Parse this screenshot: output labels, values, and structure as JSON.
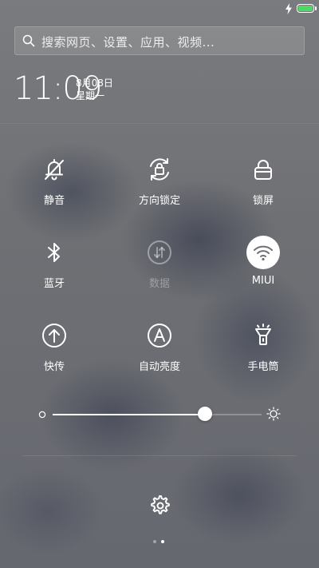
{
  "status_bar": {
    "icons": [
      "charging-icon",
      "battery-icon"
    ],
    "battery_color": "#4cd964"
  },
  "search": {
    "placeholder": "搜索网页、设置、应用、视频..."
  },
  "clock": {
    "time": "11:09",
    "date": "8月08日",
    "weekday": "星期一"
  },
  "toggles": [
    {
      "label": "静音",
      "icon": "bell-off-icon",
      "active": false,
      "disabled": false
    },
    {
      "label": "方向锁定",
      "icon": "rotation-lock-icon",
      "active": false,
      "disabled": false
    },
    {
      "label": "锁屏",
      "icon": "lock-icon",
      "active": false,
      "disabled": false
    },
    {
      "label": "蓝牙",
      "icon": "bluetooth-icon",
      "active": false,
      "disabled": false
    },
    {
      "label": "数据",
      "icon": "mobile-data-icon",
      "active": false,
      "disabled": true
    },
    {
      "label": "MIUI",
      "icon": "wifi-icon",
      "active": true,
      "disabled": false
    },
    {
      "label": "快传",
      "icon": "quick-transfer-icon",
      "active": false,
      "disabled": false
    },
    {
      "label": "自动亮度",
      "icon": "auto-brightness-icon",
      "active": false,
      "disabled": false
    },
    {
      "label": "手电筒",
      "icon": "flashlight-icon",
      "active": false,
      "disabled": false
    }
  ],
  "brightness": {
    "level": 0.73,
    "icons": [
      "brightness-low-icon",
      "brightness-high-icon"
    ]
  },
  "pager": {
    "count": 2,
    "active_index": 1
  },
  "colors": {
    "text": "#ffffff",
    "icon_active_bg": "#ffffff",
    "icon_active_fg": "#6f7075"
  }
}
